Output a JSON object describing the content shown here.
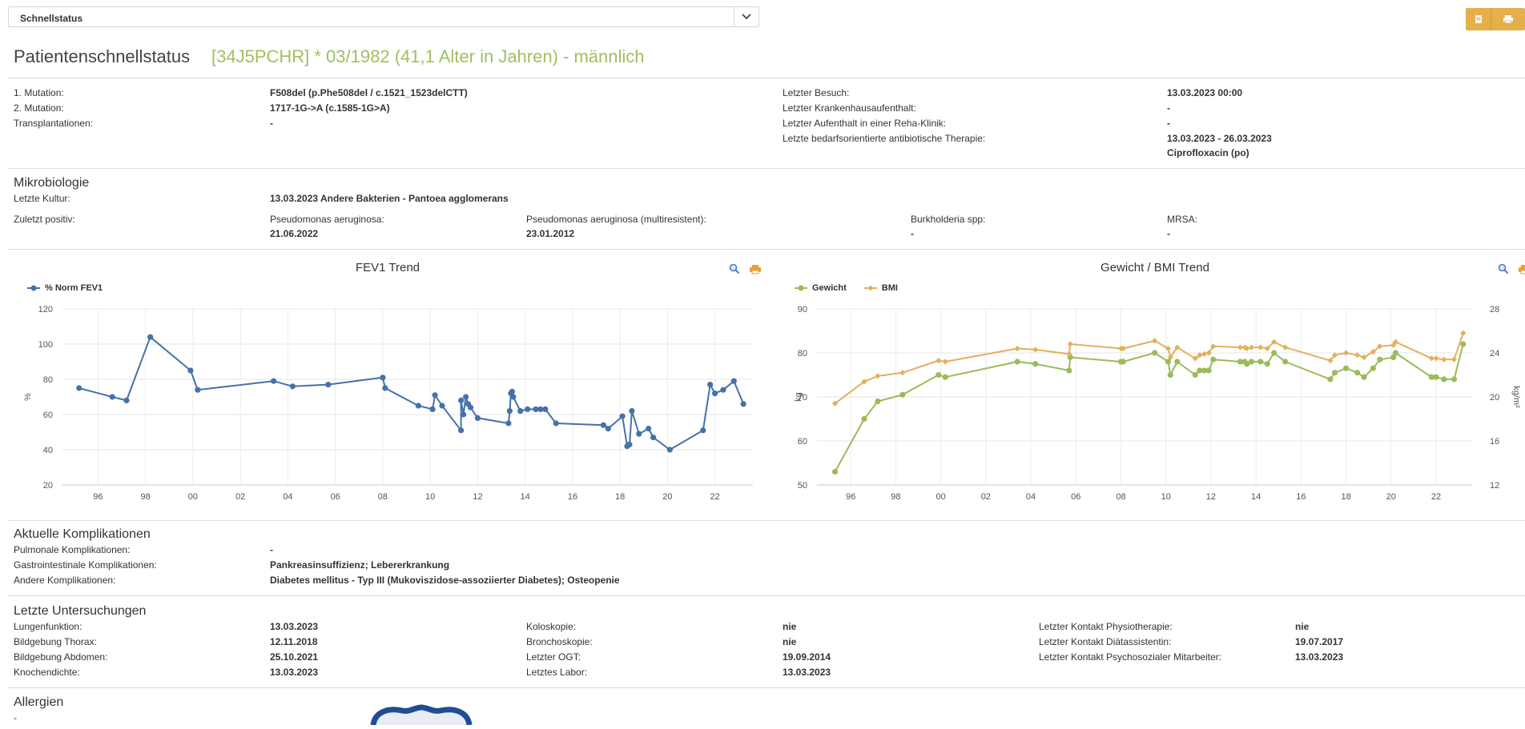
{
  "toolbar": {
    "select_value": "Schnellstatus",
    "colors": {
      "button": "#e4b04a"
    }
  },
  "header": {
    "title": "Patientenschnellstatus",
    "subtitle": "[34J5PCHR] * 03/1982 (41,1 Alter in Jahren) - männlich"
  },
  "info_left": [
    {
      "label": "1. Mutation:",
      "value": "F508del (p.Phe508del / c.1521_1523delCTT)"
    },
    {
      "label": "2. Mutation:",
      "value": "1717-1G->A (c.1585-1G>A)"
    },
    {
      "label": "Transplantationen:",
      "value": "-"
    }
  ],
  "info_right": [
    {
      "label": "Letzter Besuch:",
      "value": "13.03.2023 00:00"
    },
    {
      "label": "Letzter Krankenhausaufenthalt:",
      "value": "-"
    },
    {
      "label": "Letzter Aufenthalt in einer Reha-Klinik:",
      "value": "-"
    },
    {
      "label": "Letzte bedarfsorientierte antibiotische Therapie:",
      "value": "13.03.2023 - 26.03.2023",
      "value2": "Ciprofloxacin (po)"
    }
  ],
  "micro": {
    "title": "Mikrobiologie",
    "last_culture_label": "Letzte Kultur:",
    "last_culture_value": "13.03.2023 Andere Bakterien - Pantoea agglomerans",
    "last_positive_label": "Zuletzt positiv:",
    "items": [
      {
        "label": "Pseudomonas aeruginosa:",
        "value": "21.06.2022"
      },
      {
        "label": "Pseudomonas aeruginosa (multiresistent):",
        "value": "23.01.2012"
      },
      {
        "label": "Burkholderia spp:",
        "value": "-"
      },
      {
        "label": "MRSA:",
        "value": "-"
      }
    ]
  },
  "chart_data": [
    {
      "type": "line",
      "title": "FEV1 Trend",
      "ylabel": "%",
      "ylim": [
        20,
        120
      ],
      "yticks": [
        20,
        40,
        60,
        80,
        100,
        120
      ],
      "xlim": [
        1994.5,
        2023.6
      ],
      "xticks": [
        {
          "v": 1996,
          "l": "96"
        },
        {
          "v": 1998,
          "l": "98"
        },
        {
          "v": 2000,
          "l": "00"
        },
        {
          "v": 2002,
          "l": "02"
        },
        {
          "v": 2004,
          "l": "04"
        },
        {
          "v": 2006,
          "l": "06"
        },
        {
          "v": 2008,
          "l": "08"
        },
        {
          "v": 2010,
          "l": "10"
        },
        {
          "v": 2012,
          "l": "12"
        },
        {
          "v": 2014,
          "l": "14"
        },
        {
          "v": 2016,
          "l": "16"
        },
        {
          "v": 2018,
          "l": "18"
        },
        {
          "v": 2020,
          "l": "20"
        },
        {
          "v": 2022,
          "l": "22"
        }
      ],
      "series": [
        {
          "name": "% Norm FEV1",
          "color": "#4572a7",
          "points": [
            [
              1995.2,
              75
            ],
            [
              1996.6,
              70
            ],
            [
              1997.2,
              68
            ],
            [
              1998.2,
              104
            ],
            [
              1999.9,
              85
            ],
            [
              2000.2,
              74
            ],
            [
              2003.4,
              79
            ],
            [
              2004.2,
              76
            ],
            [
              2005.7,
              77
            ],
            [
              2008.0,
              81
            ],
            [
              2008.1,
              75
            ],
            [
              2009.5,
              65
            ],
            [
              2010.1,
              63
            ],
            [
              2010.2,
              71
            ],
            [
              2010.5,
              65
            ],
            [
              2011.3,
              51
            ],
            [
              2011.3,
              68
            ],
            [
              2011.4,
              60
            ],
            [
              2011.5,
              70
            ],
            [
              2011.6,
              66
            ],
            [
              2011.7,
              64
            ],
            [
              2012.0,
              58
            ],
            [
              2013.3,
              55
            ],
            [
              2013.35,
              62
            ],
            [
              2013.4,
              72
            ],
            [
              2013.45,
              73
            ],
            [
              2013.5,
              70
            ],
            [
              2013.8,
              62
            ],
            [
              2014.1,
              63
            ],
            [
              2014.45,
              63
            ],
            [
              2014.65,
              63
            ],
            [
              2014.85,
              63
            ],
            [
              2015.3,
              55
            ],
            [
              2017.3,
              54
            ],
            [
              2017.5,
              52
            ],
            [
              2018.1,
              59
            ],
            [
              2018.3,
              42
            ],
            [
              2018.4,
              43
            ],
            [
              2018.5,
              62
            ],
            [
              2018.8,
              49
            ],
            [
              2019.2,
              52
            ],
            [
              2019.4,
              47
            ],
            [
              2020.1,
              40
            ],
            [
              2021.5,
              51
            ],
            [
              2021.8,
              77
            ],
            [
              2022.0,
              72
            ],
            [
              2022.35,
              74
            ],
            [
              2022.8,
              79
            ],
            [
              2023.2,
              66
            ]
          ]
        }
      ]
    },
    {
      "type": "line",
      "title": "Gewicht / BMI Trend",
      "ylabel": "kg",
      "ylabel_right": "kg/m²",
      "ylim": [
        50,
        90
      ],
      "yticks": [
        50,
        60,
        70,
        80,
        90
      ],
      "ylim_right": [
        12,
        28
      ],
      "yticks_right": [
        12,
        16,
        20,
        24,
        28
      ],
      "xlim": [
        1994.5,
        2023.6
      ],
      "xticks": [
        {
          "v": 1996,
          "l": "96"
        },
        {
          "v": 1998,
          "l": "98"
        },
        {
          "v": 2000,
          "l": "00"
        },
        {
          "v": 2002,
          "l": "02"
        },
        {
          "v": 2004,
          "l": "04"
        },
        {
          "v": 2006,
          "l": "06"
        },
        {
          "v": 2008,
          "l": "08"
        },
        {
          "v": 2010,
          "l": "10"
        },
        {
          "v": 2012,
          "l": "12"
        },
        {
          "v": 2014,
          "l": "14"
        },
        {
          "v": 2016,
          "l": "16"
        },
        {
          "v": 2018,
          "l": "18"
        },
        {
          "v": 2020,
          "l": "20"
        },
        {
          "v": 2022,
          "l": "22"
        }
      ],
      "series": [
        {
          "name": "Gewicht",
          "color": "#9bbb59",
          "axis": "left",
          "points": [
            [
              1995.3,
              53
            ],
            [
              1996.6,
              65
            ],
            [
              1997.2,
              69
            ],
            [
              1998.3,
              70.5
            ],
            [
              1999.9,
              75
            ],
            [
              2000.2,
              74.5
            ],
            [
              2003.4,
              78
            ],
            [
              2004.2,
              77.5
            ],
            [
              2005.7,
              76
            ],
            [
              2005.75,
              79
            ],
            [
              2008.0,
              78
            ],
            [
              2008.1,
              78
            ],
            [
              2009.5,
              80
            ],
            [
              2010.1,
              78
            ],
            [
              2010.2,
              75
            ],
            [
              2010.5,
              78
            ],
            [
              2011.3,
              75
            ],
            [
              2011.5,
              76
            ],
            [
              2011.7,
              76
            ],
            [
              2011.9,
              76
            ],
            [
              2012.1,
              78.5
            ],
            [
              2013.3,
              78
            ],
            [
              2013.5,
              78
            ],
            [
              2013.6,
              77.5
            ],
            [
              2013.8,
              78
            ],
            [
              2014.2,
              78
            ],
            [
              2014.5,
              77.5
            ],
            [
              2014.8,
              80
            ],
            [
              2015.3,
              78
            ],
            [
              2017.3,
              74
            ],
            [
              2017.5,
              75.5
            ],
            [
              2018.0,
              76.5
            ],
            [
              2018.5,
              75.5
            ],
            [
              2018.8,
              74.5
            ],
            [
              2019.2,
              76.5
            ],
            [
              2019.5,
              78.5
            ],
            [
              2020.1,
              79
            ],
            [
              2020.2,
              80
            ],
            [
              2021.8,
              74.5
            ],
            [
              2022.0,
              74.5
            ],
            [
              2022.35,
              74
            ],
            [
              2022.8,
              74
            ],
            [
              2023.2,
              82
            ]
          ]
        },
        {
          "name": "BMI",
          "color": "#e3b05c",
          "axis": "right",
          "points": [
            [
              1995.3,
              19.4
            ],
            [
              1996.6,
              21.4
            ],
            [
              1997.2,
              21.9
            ],
            [
              1998.3,
              22.2
            ],
            [
              1999.9,
              23.3
            ],
            [
              2000.2,
              23.2
            ],
            [
              2003.4,
              24.4
            ],
            [
              2004.2,
              24.3
            ],
            [
              2005.7,
              23.9
            ],
            [
              2005.75,
              24.8
            ],
            [
              2008.0,
              24.4
            ],
            [
              2008.1,
              24.4
            ],
            [
              2009.5,
              25.1
            ],
            [
              2010.1,
              24.4
            ],
            [
              2010.2,
              23.6
            ],
            [
              2010.5,
              24.5
            ],
            [
              2011.3,
              23.5
            ],
            [
              2011.5,
              23.8
            ],
            [
              2011.7,
              23.9
            ],
            [
              2011.9,
              24.0
            ],
            [
              2012.1,
              24.6
            ],
            [
              2013.3,
              24.5
            ],
            [
              2013.5,
              24.5
            ],
            [
              2013.6,
              24.4
            ],
            [
              2013.8,
              24.5
            ],
            [
              2014.2,
              24.5
            ],
            [
              2014.5,
              24.4
            ],
            [
              2014.8,
              25.0
            ],
            [
              2015.3,
              24.5
            ],
            [
              2017.3,
              23.3
            ],
            [
              2017.5,
              23.8
            ],
            [
              2018.0,
              24.0
            ],
            [
              2018.5,
              23.8
            ],
            [
              2018.8,
              23.6
            ],
            [
              2019.2,
              24.1
            ],
            [
              2019.5,
              24.6
            ],
            [
              2020.1,
              24.7
            ],
            [
              2020.2,
              25.0
            ],
            [
              2021.8,
              23.5
            ],
            [
              2022.0,
              23.5
            ],
            [
              2022.35,
              23.4
            ],
            [
              2022.8,
              23.4
            ],
            [
              2023.2,
              25.8
            ]
          ]
        }
      ]
    }
  ],
  "complications": {
    "title": "Aktuelle Komplikationen",
    "rows": [
      {
        "label": "Pulmonale Komplikationen:",
        "value": "-"
      },
      {
        "label": "Gastrointestinale Komplikationen:",
        "value": "Pankreasinsuffizienz; Lebererkrankung"
      },
      {
        "label": "Andere Komplikationen:",
        "value": "Diabetes mellitus - Typ III (Mukoviszidose-assoziierter Diabetes); Osteopenie"
      }
    ]
  },
  "exams": {
    "title": "Letzte Untersuchungen",
    "col1": [
      {
        "label": "Lungenfunktion:",
        "value": "13.03.2023"
      },
      {
        "label": "Bildgebung Thorax:",
        "value": "12.11.2018"
      },
      {
        "label": "Bildgebung Abdomen:",
        "value": "25.10.2021"
      },
      {
        "label": "Knochendichte:",
        "value": "13.03.2023"
      }
    ],
    "col2": [
      {
        "label": "Koloskopie:",
        "value": "nie"
      },
      {
        "label": "Bronchoskopie:",
        "value": "nie"
      },
      {
        "label": "Letzter OGT:",
        "value": "19.09.2014"
      },
      {
        "label": "Letztes Labor:",
        "value": "13.03.2023"
      }
    ],
    "col3": [
      {
        "label": "Letzter Kontakt Physiotherapie:",
        "value": "nie"
      },
      {
        "label": "Letzter Kontakt Diätassistentin:",
        "value": "19.07.2017"
      },
      {
        "label": "Letzter Kontakt Psychosozialer Mitarbeiter:",
        "value": "13.03.2023"
      }
    ]
  },
  "allergies": {
    "title": "Allergien",
    "value": "-"
  }
}
